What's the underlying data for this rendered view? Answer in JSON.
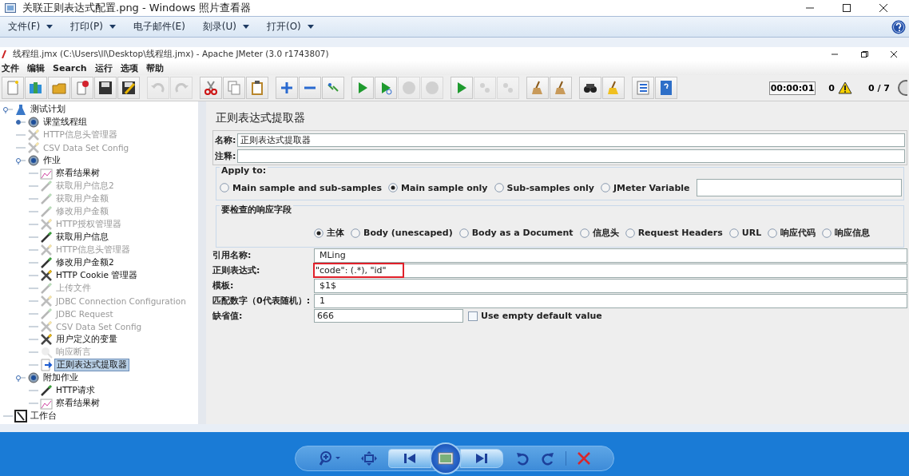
{
  "viewer": {
    "title": "关联正则表达式配置.png - Windows 照片查看器",
    "menu": [
      {
        "label": "文件(F)",
        "dropdown": true
      },
      {
        "label": "打印(P)",
        "dropdown": true
      },
      {
        "label": "电子邮件(E)",
        "dropdown": false
      },
      {
        "label": "刻录(U)",
        "dropdown": true
      },
      {
        "label": "打开(O)",
        "dropdown": true
      }
    ]
  },
  "jmeter": {
    "title": "线程组.jmx (C:\\Users\\ll\\Desktop\\线程组.jmx) - Apache JMeter (3.0 r1743807)",
    "menu": [
      "文件",
      "编辑",
      "Search",
      "运行",
      "选项",
      "帮助"
    ],
    "toolbar": [
      [
        {
          "kind": "new",
          "disabled": false
        },
        {
          "kind": "templates",
          "disabled": false
        },
        {
          "kind": "open",
          "disabled": false
        },
        {
          "kind": "close",
          "disabled": false
        },
        {
          "kind": "save",
          "disabled": false
        },
        {
          "kind": "save-as",
          "disabled": false
        }
      ],
      [
        {
          "kind": "undo",
          "disabled": true
        },
        {
          "kind": "redo",
          "disabled": true
        }
      ],
      [
        {
          "kind": "cut",
          "disabled": false
        },
        {
          "kind": "copy",
          "disabled": false
        },
        {
          "kind": "paste",
          "disabled": false
        }
      ],
      [
        {
          "kind": "expand",
          "disabled": false
        },
        {
          "kind": "collapse",
          "disabled": false
        },
        {
          "kind": "toggle",
          "disabled": false
        }
      ],
      [
        {
          "kind": "start",
          "disabled": false
        },
        {
          "kind": "start-no-pause",
          "disabled": false
        },
        {
          "kind": "stop",
          "disabled": true
        },
        {
          "kind": "shutdown",
          "disabled": true
        }
      ],
      [
        {
          "kind": "remote-start",
          "disabled": false
        },
        {
          "kind": "remote-stop",
          "disabled": true
        },
        {
          "kind": "remote-shutdown",
          "disabled": true
        }
      ],
      [
        {
          "kind": "clear",
          "disabled": false
        },
        {
          "kind": "clear-all",
          "disabled": false
        }
      ],
      [
        {
          "kind": "search",
          "disabled": false
        },
        {
          "kind": "reset-search",
          "disabled": false
        }
      ],
      [
        {
          "kind": "functions",
          "disabled": false
        },
        {
          "kind": "help",
          "disabled": false
        }
      ]
    ],
    "timer": "00:00:01",
    "warnings": "0",
    "threads": "0 / 7",
    "tree": [
      {
        "label": "测试计划",
        "kind": "plan",
        "disabled": false,
        "selected": false,
        "expanded": true,
        "children": [
          {
            "label": "课堂线程组",
            "kind": "threads",
            "disabled": false,
            "selected": false,
            "expanded": false
          },
          {
            "label": "HTTP信息头管理器",
            "kind": "config",
            "disabled": true,
            "selected": false
          },
          {
            "label": "CSV Data Set Config",
            "kind": "config",
            "disabled": true,
            "selected": false
          },
          {
            "label": "作业",
            "kind": "threads",
            "disabled": false,
            "selected": false,
            "expanded": true,
            "children": [
              {
                "label": "察看结果树",
                "kind": "listener",
                "disabled": false,
                "selected": false
              },
              {
                "label": "获取用户信息2",
                "kind": "sampler",
                "disabled": true,
                "selected": false
              },
              {
                "label": "获取用户金额",
                "kind": "sampler",
                "disabled": true,
                "selected": false
              },
              {
                "label": "修改用户金额",
                "kind": "sampler",
                "disabled": true,
                "selected": false
              },
              {
                "label": "HTTP授权管理器",
                "kind": "config",
                "disabled": true,
                "selected": false
              },
              {
                "label": "获取用户信息",
                "kind": "sampler",
                "disabled": false,
                "selected": false
              },
              {
                "label": "HTTP信息头管理器",
                "kind": "config",
                "disabled": true,
                "selected": false
              },
              {
                "label": "修改用户金额2",
                "kind": "sampler",
                "disabled": false,
                "selected": false
              },
              {
                "label": "HTTP Cookie 管理器",
                "kind": "config",
                "disabled": false,
                "selected": false
              },
              {
                "label": "上传文件",
                "kind": "sampler",
                "disabled": true,
                "selected": false
              },
              {
                "label": "JDBC Connection Configuration",
                "kind": "config",
                "disabled": true,
                "selected": false
              },
              {
                "label": "JDBC Request",
                "kind": "sampler",
                "disabled": true,
                "selected": false
              },
              {
                "label": "CSV Data Set Config",
                "kind": "config",
                "disabled": true,
                "selected": false
              },
              {
                "label": "用户定义的变量",
                "kind": "config",
                "disabled": false,
                "selected": false
              },
              {
                "label": "响应断言",
                "kind": "assertion",
                "disabled": true,
                "selected": false
              },
              {
                "label": "正则表达式提取器",
                "kind": "extractor",
                "disabled": false,
                "selected": true
              }
            ]
          },
          {
            "label": "附加作业",
            "kind": "threads",
            "disabled": false,
            "selected": false,
            "expanded": true,
            "children": [
              {
                "label": "HTTP请求",
                "kind": "sampler",
                "disabled": false,
                "selected": false
              },
              {
                "label": "察看结果树",
                "kind": "listener",
                "disabled": false,
                "selected": false
              }
            ]
          }
        ]
      },
      {
        "label": "工作台",
        "kind": "workbench",
        "disabled": false,
        "selected": false
      }
    ],
    "panel": {
      "title": "正则表达式提取器",
      "name": {
        "label": "名称:",
        "value": "正则表达式提取器"
      },
      "comment": {
        "label": "注释:"
      },
      "apply_to": {
        "legend": "Apply to:",
        "options": [
          {
            "label": "Main sample and sub-samples",
            "selected": false
          },
          {
            "label": "Main sample only",
            "selected": true
          },
          {
            "label": "Sub-samples only",
            "selected": false
          },
          {
            "label": "JMeter Variable",
            "selected": false
          }
        ]
      },
      "field_to_check": {
        "legend": "要检查的响应字段",
        "options": [
          {
            "label": "主体",
            "selected": true
          },
          {
            "label": "Body (unescaped)",
            "selected": false
          },
          {
            "label": "Body as a Document",
            "selected": false
          },
          {
            "label": "信息头",
            "selected": false
          },
          {
            "label": "Request Headers",
            "selected": false
          },
          {
            "label": "URL",
            "selected": false
          },
          {
            "label": "响应代码",
            "selected": false
          },
          {
            "label": "响应信息",
            "selected": false
          }
        ]
      },
      "fields": [
        {
          "label": "引用名称:",
          "value": "MLing",
          "highlighted": false
        },
        {
          "label": "正则表达式:",
          "value": "\"code\": (.*), \"id\"",
          "highlighted": true
        },
        {
          "label": "模板:",
          "value": "$1$",
          "highlighted": false
        },
        {
          "label": "匹配数字（0代表随机）:",
          "value": "1",
          "highlighted": false
        }
      ],
      "default": {
        "label": "缺省值:",
        "value": "666",
        "checkbox": {
          "label": "Use empty default value",
          "checked": false
        }
      }
    }
  }
}
